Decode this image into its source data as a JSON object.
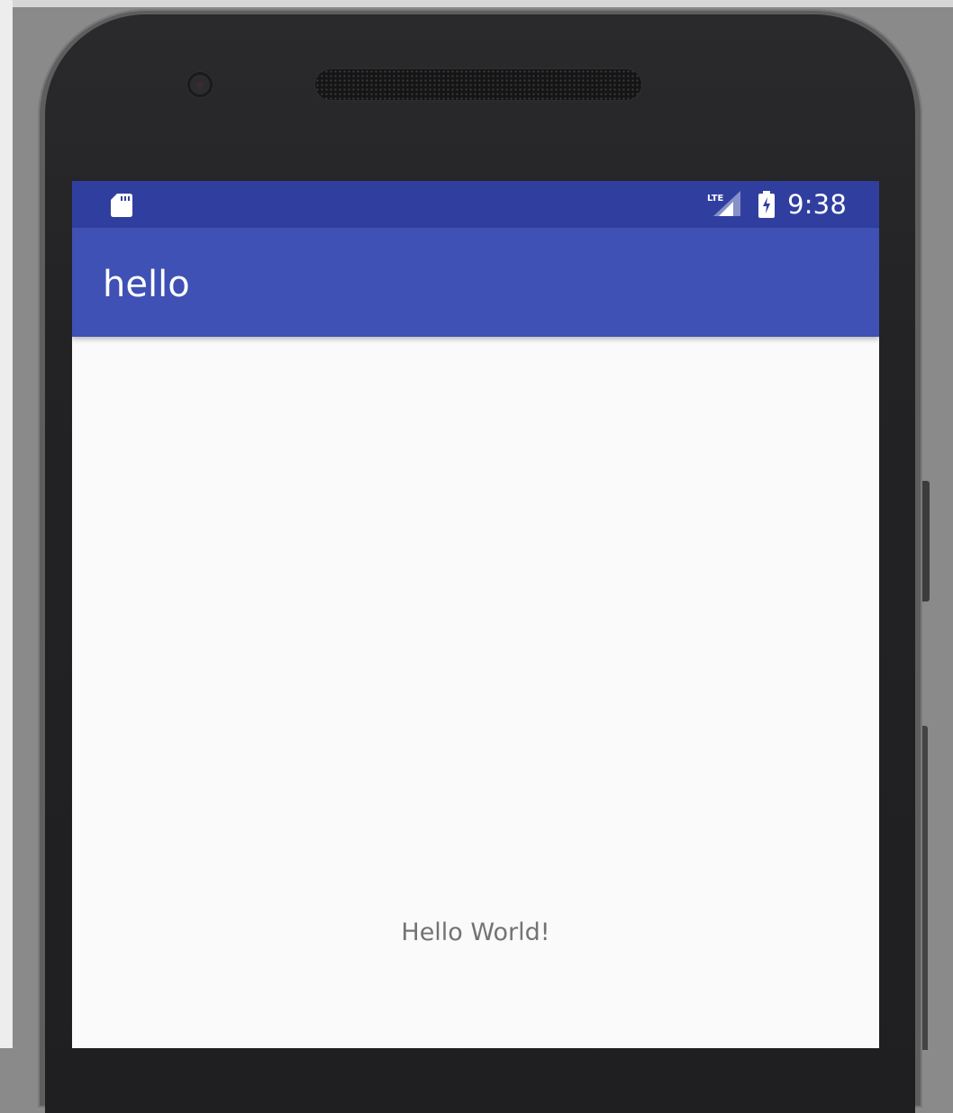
{
  "status_bar": {
    "time": "9:38",
    "left_icon": "sd-card-icon",
    "network_icon": "lte-signal-icon",
    "network_label": "LTE",
    "battery_icon": "battery-charging-icon",
    "color": "#303f9f"
  },
  "app_bar": {
    "title": "hello",
    "color": "#3f51b5"
  },
  "content": {
    "message": "Hello World!",
    "background": "#fafafa"
  },
  "device": {
    "front_camera_icon": "front-camera-icon",
    "earpiece_icon": "speaker-grille-icon"
  }
}
